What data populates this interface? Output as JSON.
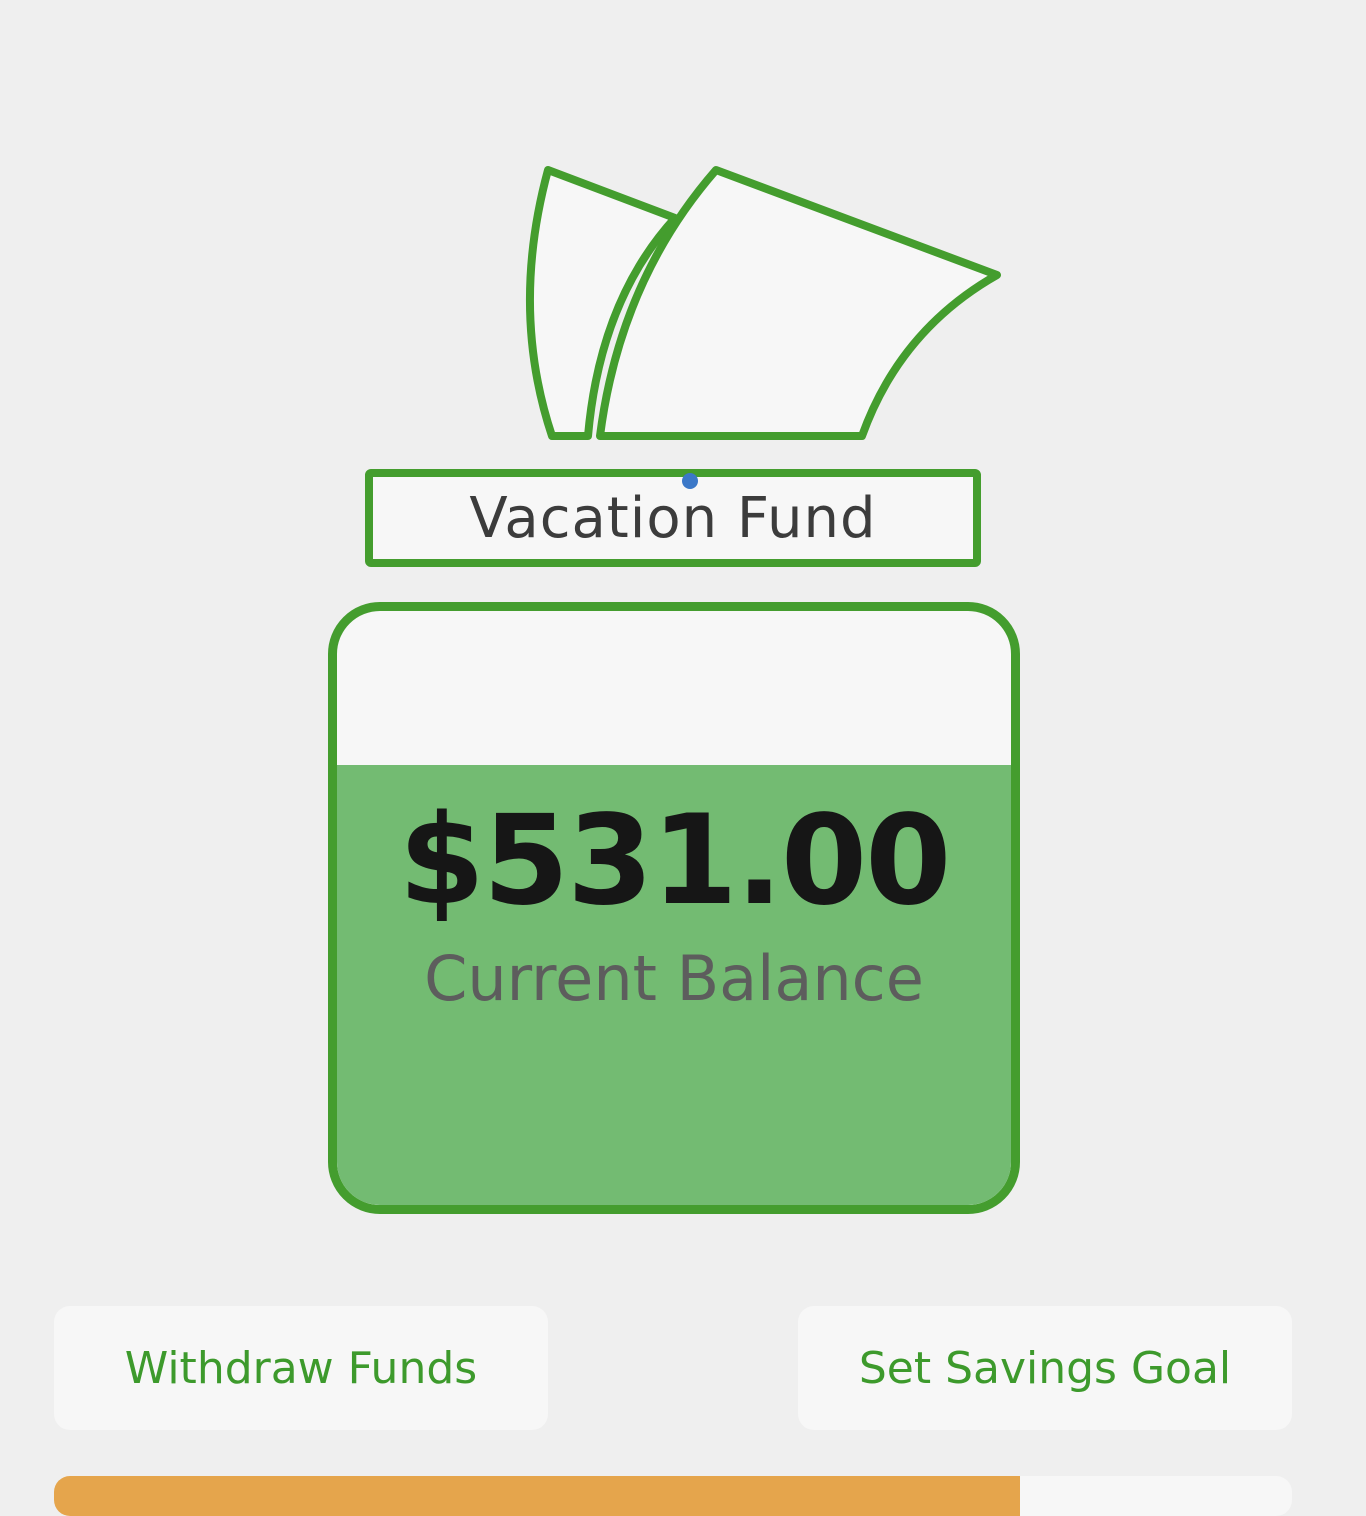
{
  "jar": {
    "name": "Vacation Fund",
    "balance": "$531.00",
    "balance_caption": "Current Balance",
    "fill_level": 0.74
  },
  "actions": {
    "withdraw_label": "Withdraw Funds",
    "goal_label": "Set Savings Goal"
  },
  "goal_progress": {
    "fraction": 0.78
  },
  "colors": {
    "brand_green": "#449d2e",
    "fill_green": "#73bb72",
    "progress_orange": "#e5a54c"
  },
  "icons": [
    "money-bills-icon"
  ]
}
